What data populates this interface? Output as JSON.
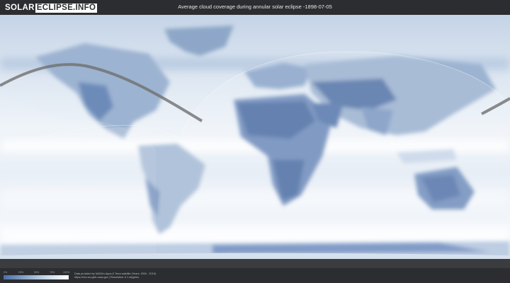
{
  "header": {
    "logo_left": "SOLAR",
    "logo_right": "ECLIPSE.INFO",
    "title": "Average cloud coverage during annular solar eclipse -1898-07-05"
  },
  "legend": {
    "ticks": [
      "0%",
      "25%",
      "50%",
      "75%",
      "100%"
    ],
    "colors": [
      "#4d6ea8",
      "#8aa5c9",
      "#cbd9ea",
      "#ffffff"
    ]
  },
  "credits": {
    "line1": "Data provided by NASA's Aqua & Terra satellite (Years: 2000 - 2019)",
    "line2": "https://neo.sci.gsfc.nasa.gov | Resolution: 0.1 degrees"
  },
  "colors": {
    "background": "#2f3134",
    "cloud_dense": "#eef3f9",
    "clear_sky": "#5676a8",
    "eclipse_path": "#6f6f6f"
  }
}
